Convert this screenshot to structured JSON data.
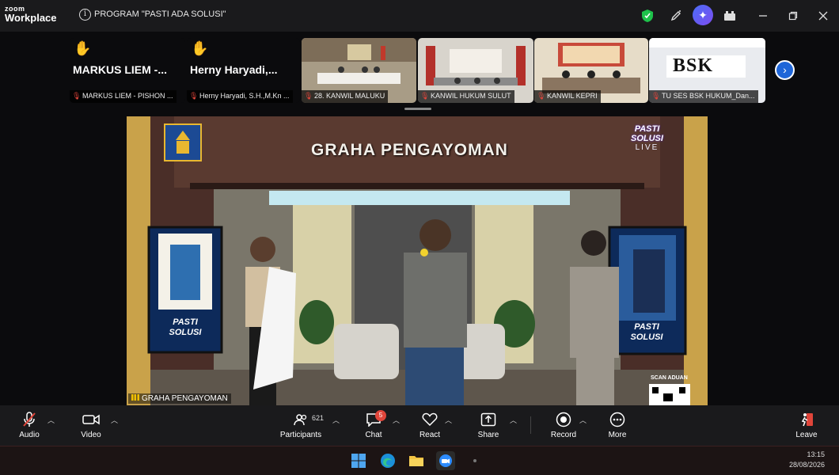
{
  "app": {
    "brand_top": "zoom",
    "brand_bottom": "Workplace",
    "meeting_title": "PROGRAM \"PASTI ADA SOLUSI\""
  },
  "titlebar_icons": [
    "info-icon",
    "shield-icon",
    "pen-icon",
    "ai-companion-icon",
    "apps-icon",
    "minimize-icon",
    "maximize-icon",
    "close-icon"
  ],
  "participants": [
    {
      "big_name": "MARKUS LIEM -...",
      "label": "MARKUS LIEM - PISHON ...",
      "hand_raised": true,
      "video": false
    },
    {
      "big_name": "Herny Haryadi,...",
      "label": "Herny Haryadi, S.H.,M.Kn ...",
      "hand_raised": true,
      "video": false
    },
    {
      "label": "28. KANWIL MALUKU",
      "video": true,
      "color": "#9b8e7a"
    },
    {
      "label": "KANWIL HUKUM SULUT",
      "video": true,
      "color": "#b8342c"
    },
    {
      "label": "KANWIL KEPRI",
      "video": true,
      "color": "#c66a3a"
    },
    {
      "label": "TU SES BSK HUKUM_Dan...",
      "video": true,
      "color": "#d9dce3",
      "overlay": "BSK"
    }
  ],
  "main_video": {
    "label": "GRAHA PENGAYOMAN",
    "banner": "GRAHA PENGAYOMAN",
    "show_logo_line1": "PASTI",
    "show_logo_line2": "SOLUSI",
    "show_logo_line3": "LIVE",
    "panel_left_line1": "PASTI",
    "panel_left_line2": "SOLUSI",
    "panel_right_line1": "PASTI",
    "panel_right_line2": "SOLUSI",
    "scan_label": "SCAN ADUAN"
  },
  "toolbar": {
    "audio": "Audio",
    "video": "Video",
    "participants": "Participants",
    "participants_count": "621",
    "chat": "Chat",
    "chat_badge": "5",
    "react": "React",
    "share": "Share",
    "record": "Record",
    "more": "More",
    "leave": "Leave"
  },
  "taskbar": {
    "time": "13:15",
    "date": "28/08/2026"
  }
}
